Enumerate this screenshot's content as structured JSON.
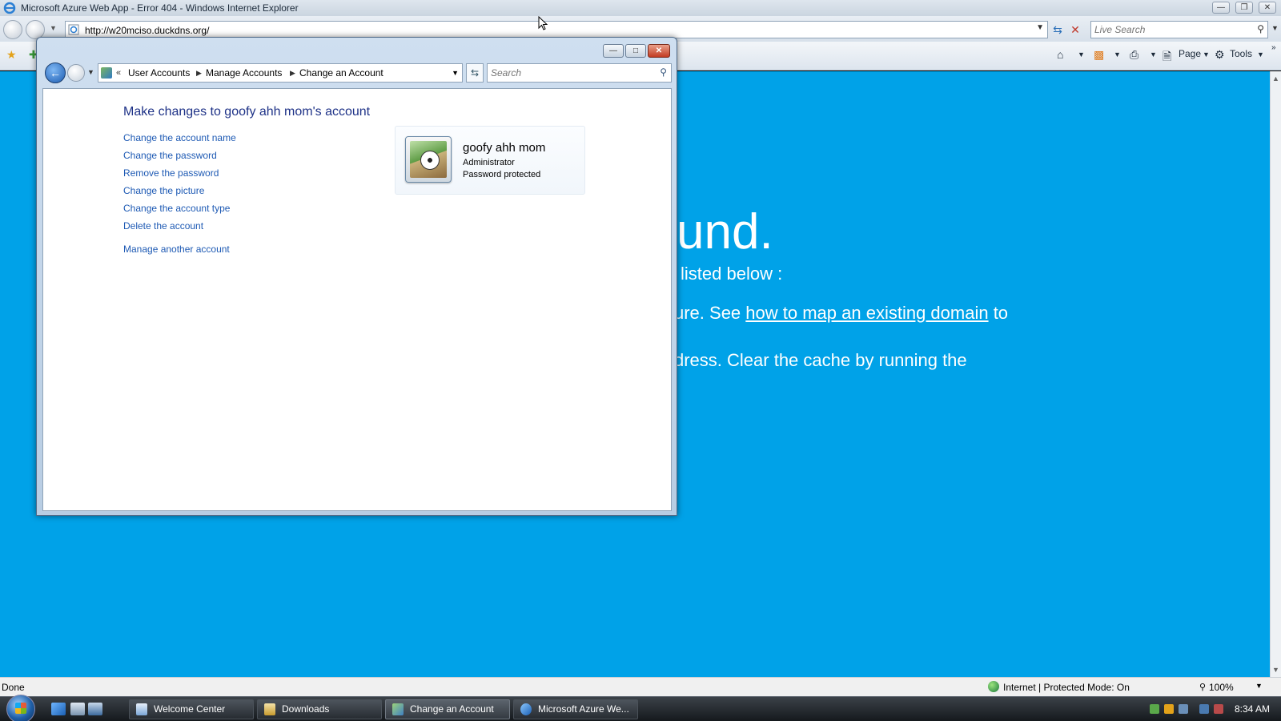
{
  "ie": {
    "title": "Microsoft Azure Web App - Error 404 - Windows Internet Explorer",
    "url": "http://w20mciso.duckdns.org/",
    "search_placeholder": "Live Search",
    "cmd_page": "Page",
    "cmd_tools": "Tools",
    "status": "Done",
    "zone": "Internet | Protected Mode: On",
    "zoom": "100%"
  },
  "page": {
    "heading_fragment": "und.",
    "line1": "listed below :",
    "line2_prefix": "ure. See ",
    "line2_link": "how to map an existing domain",
    "line2_suffix": " to",
    "line3": "dress. Clear the cache by running the"
  },
  "cp": {
    "breadcrumbs": [
      "User Accounts",
      "Manage Accounts",
      "Change an Account"
    ],
    "search_placeholder": "Search",
    "heading": "Make changes to goofy ahh mom's account",
    "tasks": [
      "Change the account name",
      "Change the password",
      "Remove the password",
      "Change the picture",
      "Change the account type",
      "Delete the account"
    ],
    "manage_another": "Manage another account",
    "account": {
      "name": "goofy ahh mom",
      "type": "Administrator",
      "password_status": "Password protected"
    }
  },
  "taskbar": {
    "buttons": [
      "Welcome Center",
      "Downloads",
      "Change an Account",
      "Microsoft Azure We..."
    ],
    "clock": "8:34 AM"
  },
  "colors": {
    "azure_bg": "#00a2e8",
    "link_blue": "#1e5ab4",
    "heading_blue": "#1e3287"
  }
}
